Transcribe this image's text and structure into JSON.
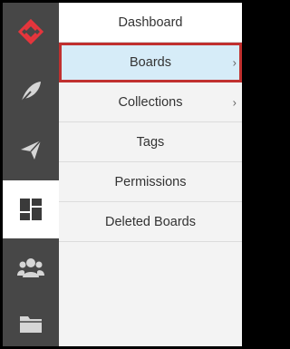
{
  "brand": {
    "icon": "logo-icon",
    "color": "#e5353c"
  },
  "rail": [
    {
      "icon": "feather-icon"
    },
    {
      "icon": "send-icon"
    },
    {
      "icon": "dashboard-icon",
      "active": true
    },
    {
      "icon": "users-icon"
    },
    {
      "icon": "folder-icon"
    }
  ],
  "menu": {
    "header": "Dashboard",
    "items": [
      {
        "label": "Boards",
        "chevron": "›",
        "highlighted": true
      },
      {
        "label": "Collections",
        "chevron": "›"
      },
      {
        "label": "Tags"
      },
      {
        "label": "Permissions"
      },
      {
        "label": "Deleted Boards"
      }
    ]
  },
  "colors": {
    "rail": "#474747",
    "highlight_fill": "#d6ecf8",
    "highlight_border": "#c0302f"
  }
}
